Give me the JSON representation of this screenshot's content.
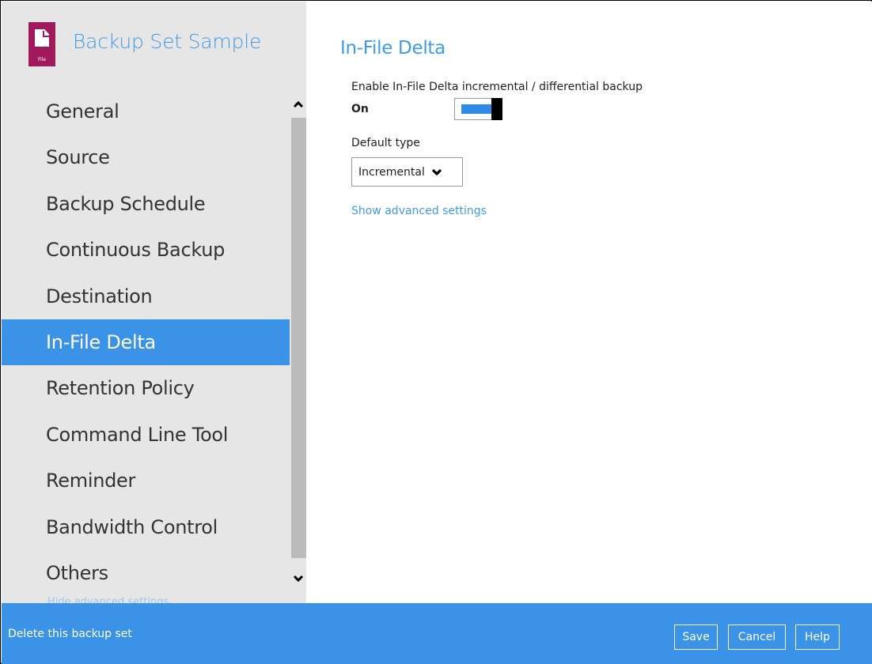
{
  "app": {
    "title": "Backup Set Sample",
    "file_icon_label": "File",
    "brand_color": "#3a93e6",
    "icon_color": "#a0195a"
  },
  "sidebar": {
    "items": [
      {
        "label": "General",
        "active": false
      },
      {
        "label": "Source",
        "active": false
      },
      {
        "label": "Backup Schedule",
        "active": false
      },
      {
        "label": "Continuous Backup",
        "active": false
      },
      {
        "label": "Destination",
        "active": false
      },
      {
        "label": "In-File Delta",
        "active": true
      },
      {
        "label": "Retention Policy",
        "active": false
      },
      {
        "label": "Command Line Tool",
        "active": false
      },
      {
        "label": "Reminder",
        "active": false
      },
      {
        "label": "Bandwidth Control",
        "active": false
      },
      {
        "label": "Others",
        "active": false
      }
    ],
    "cutoff_link": "Hide advanced settings"
  },
  "main": {
    "section_title": "In-File Delta",
    "enable_label": "Enable In-File Delta incremental / differential backup",
    "toggle_state_label": "On",
    "toggle_on": true,
    "default_type_label": "Default type",
    "default_type_value": "Incremental",
    "advanced_link": "Show advanced settings"
  },
  "footer": {
    "delete_label": "Delete this backup set",
    "save_label": "Save",
    "cancel_label": "Cancel",
    "help_label": "Help"
  }
}
